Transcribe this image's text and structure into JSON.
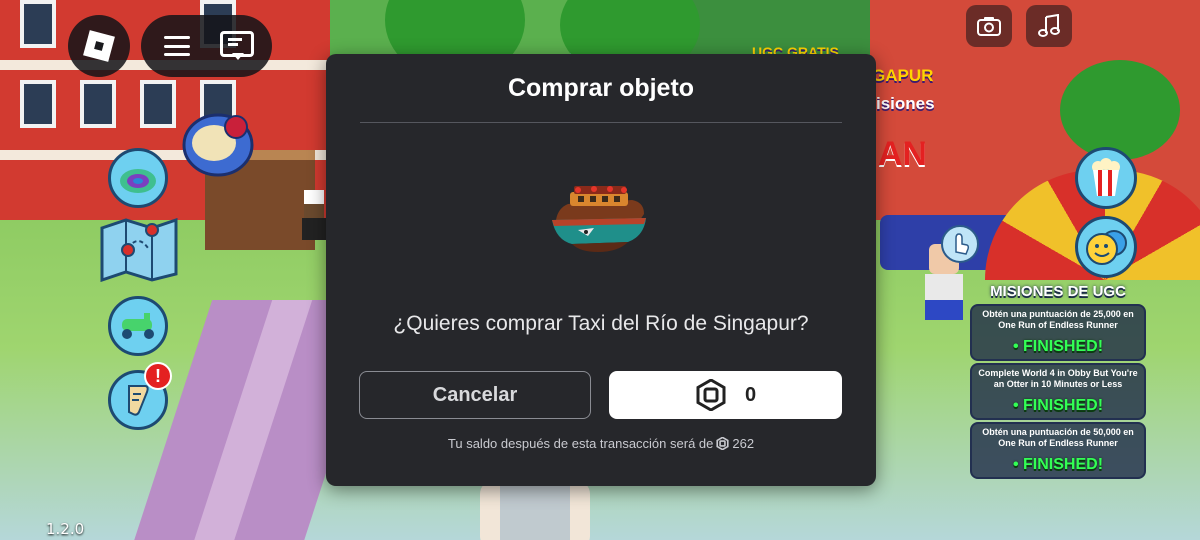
{
  "version": "1.2.0",
  "topbar": {
    "roblox_menu": "roblox-logo-icon",
    "menu": "hamburger-menu-icon",
    "chat": "chat-icon",
    "camera": "camera-icon",
    "music": "music-note-icon"
  },
  "world_signs": {
    "sign1": "UGC GRATIS",
    "sign2": "GAPUR",
    "sign3": "isiones",
    "sign4": "AN"
  },
  "quests": {
    "title": "MISIONES DE UGC",
    "items": [
      {
        "text": "Obtén una puntuación de 25,000 en One Run of Endless Runner",
        "status": "• FINISHED!"
      },
      {
        "text": "Complete World 4 in Obby But You're an Otter in 10 Minutes or Less",
        "status": "• FINISHED!"
      },
      {
        "text": "Obtén una puntuación de 50,000 en One Run of Endless Runner",
        "status": "• FINISHED!"
      }
    ]
  },
  "modal": {
    "title": "Comprar objeto",
    "item_name": "Taxi del Río de Singapur",
    "prompt": "¿Quieres comprar Taxi del Río de Singapur?",
    "cancel_label": "Cancelar",
    "price": "0",
    "balance_prefix": "Tu saldo después de esta transacción será de",
    "balance_value": "262"
  },
  "colors": {
    "modal_bg": "#26272b",
    "buy_button_bg": "#ffffff",
    "quest_finished": "#33ff55"
  }
}
